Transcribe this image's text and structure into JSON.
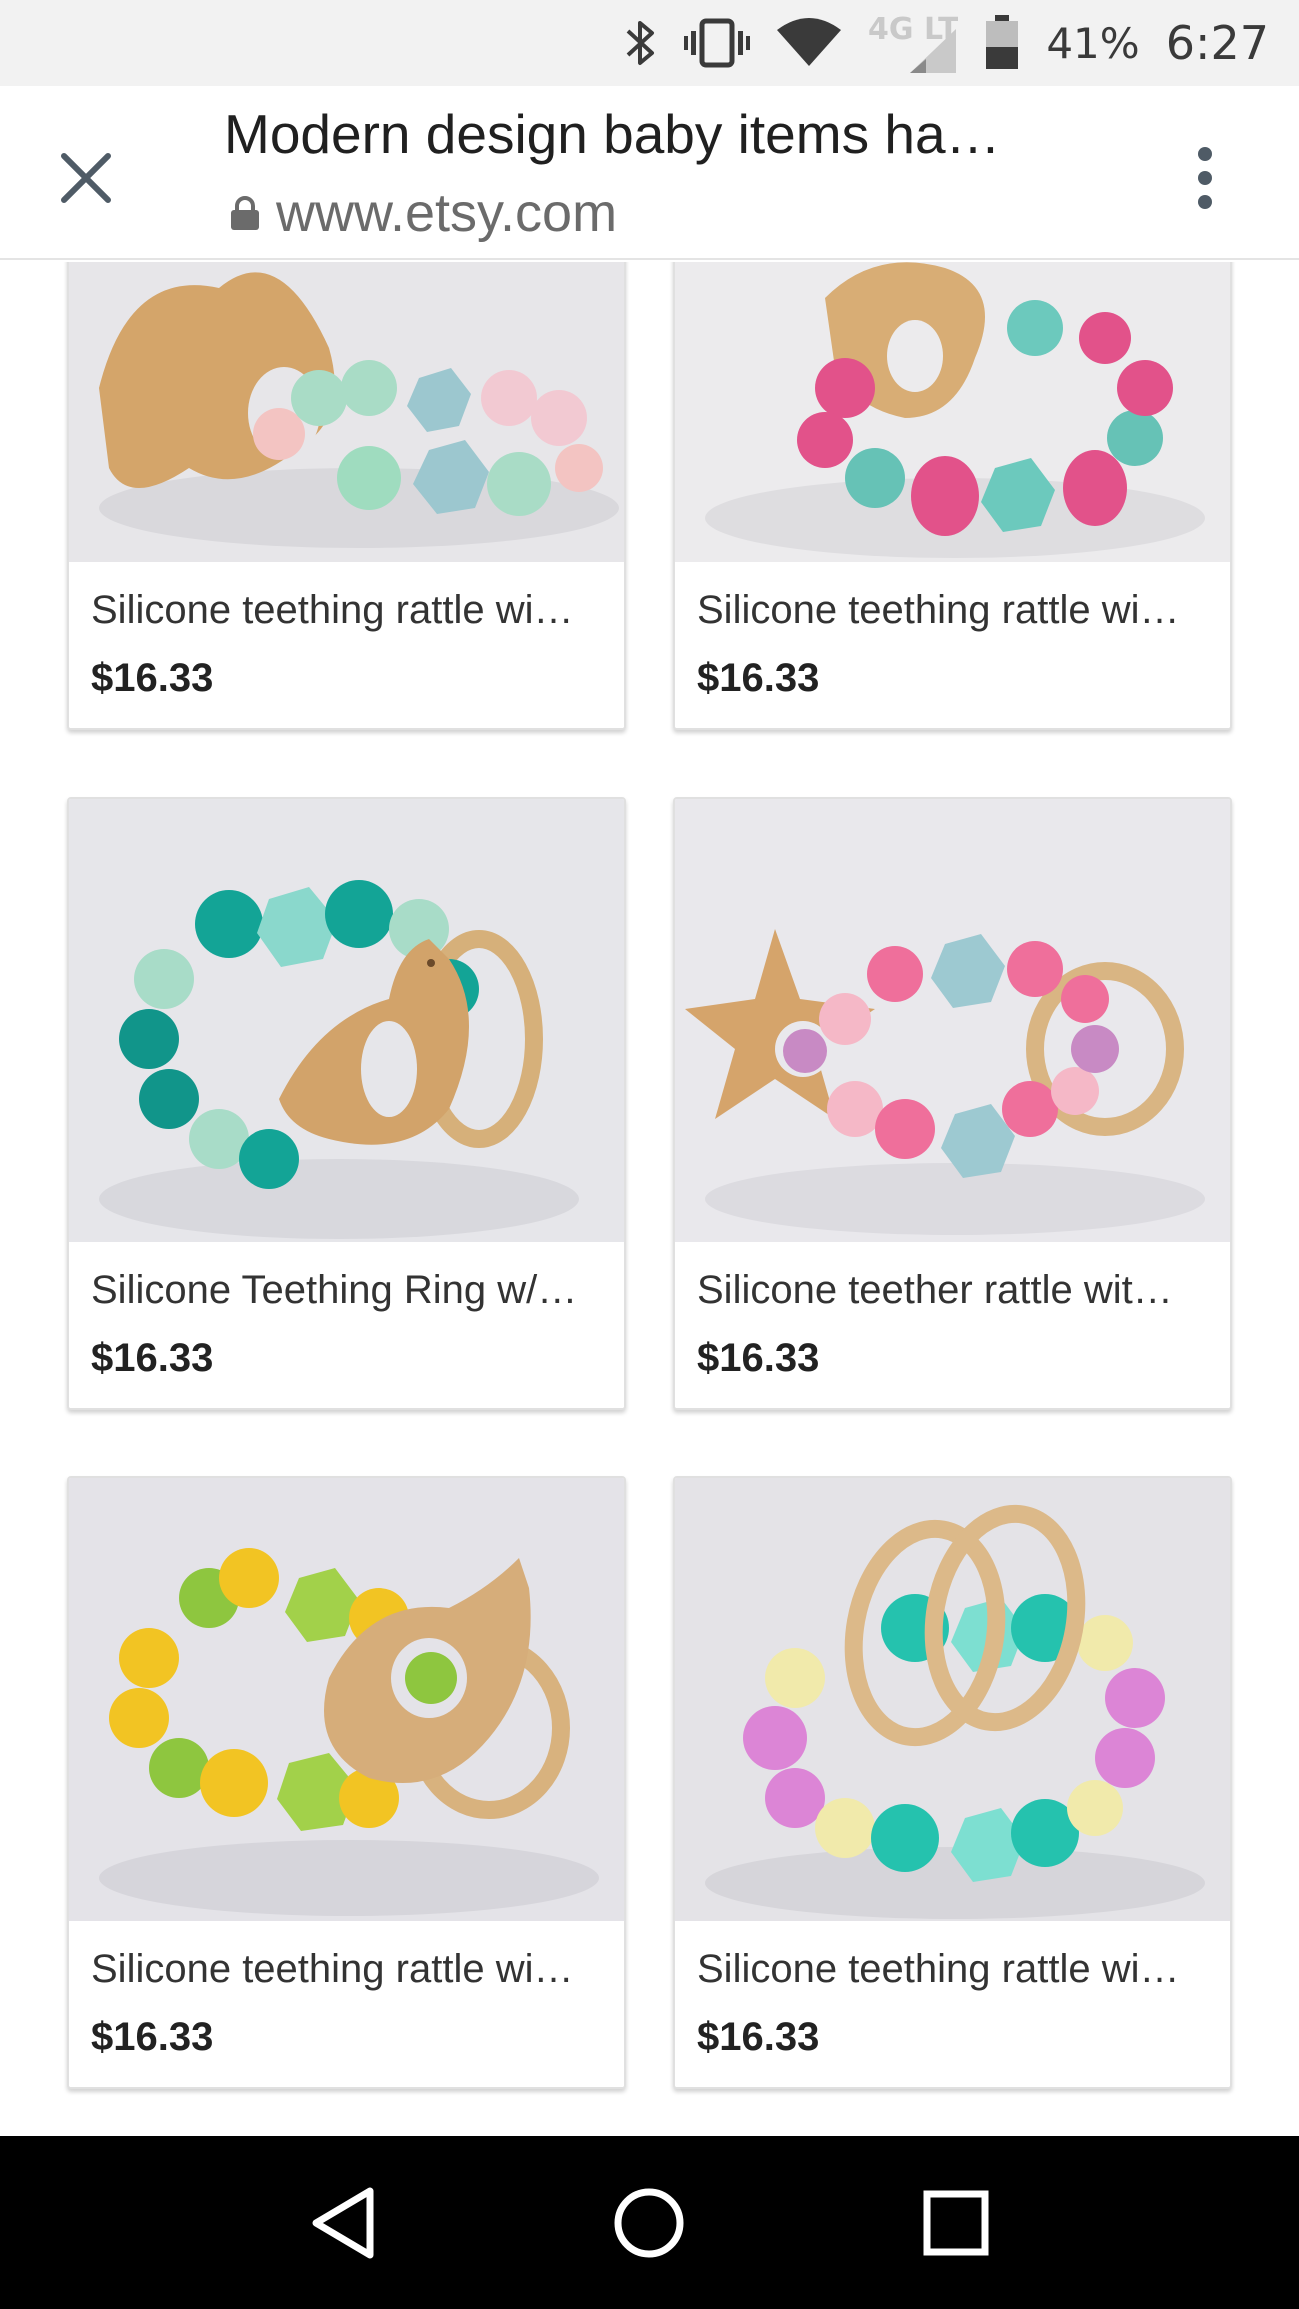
{
  "status_bar": {
    "network": "4G LTE",
    "battery": "41%",
    "time": "6:27",
    "icons": [
      "bluetooth-icon",
      "vibrate-icon",
      "wifi-icon",
      "signal-icon",
      "battery-icon"
    ]
  },
  "toolbar": {
    "title": "Modern design baby items ha…",
    "url": "www.etsy.com",
    "icons": [
      "close-icon",
      "lock-icon",
      "more-vert-icon"
    ]
  },
  "products": [
    {
      "name": "Silicone teething rattle wi…",
      "price": "$16.33"
    },
    {
      "name": "Silicone teething rattle wi…",
      "price": "$16.33"
    },
    {
      "name": "Silicone Teething Ring w/…",
      "price": "$16.33"
    },
    {
      "name": "Silicone teether rattle wit…",
      "price": "$16.33"
    },
    {
      "name": "Silicone teething rattle wi…",
      "price": "$16.33"
    },
    {
      "name": "Silicone teething rattle wi…",
      "price": "$16.33"
    }
  ],
  "nav_bar": {
    "icons": [
      "back-icon",
      "home-icon",
      "recents-icon"
    ]
  },
  "colors": {
    "status_bar_bg": "#f2f2f2",
    "toolbar_bg": "#ffffff",
    "nav_bar_bg": "#000000",
    "photo_bg": "#e9e8ea"
  }
}
